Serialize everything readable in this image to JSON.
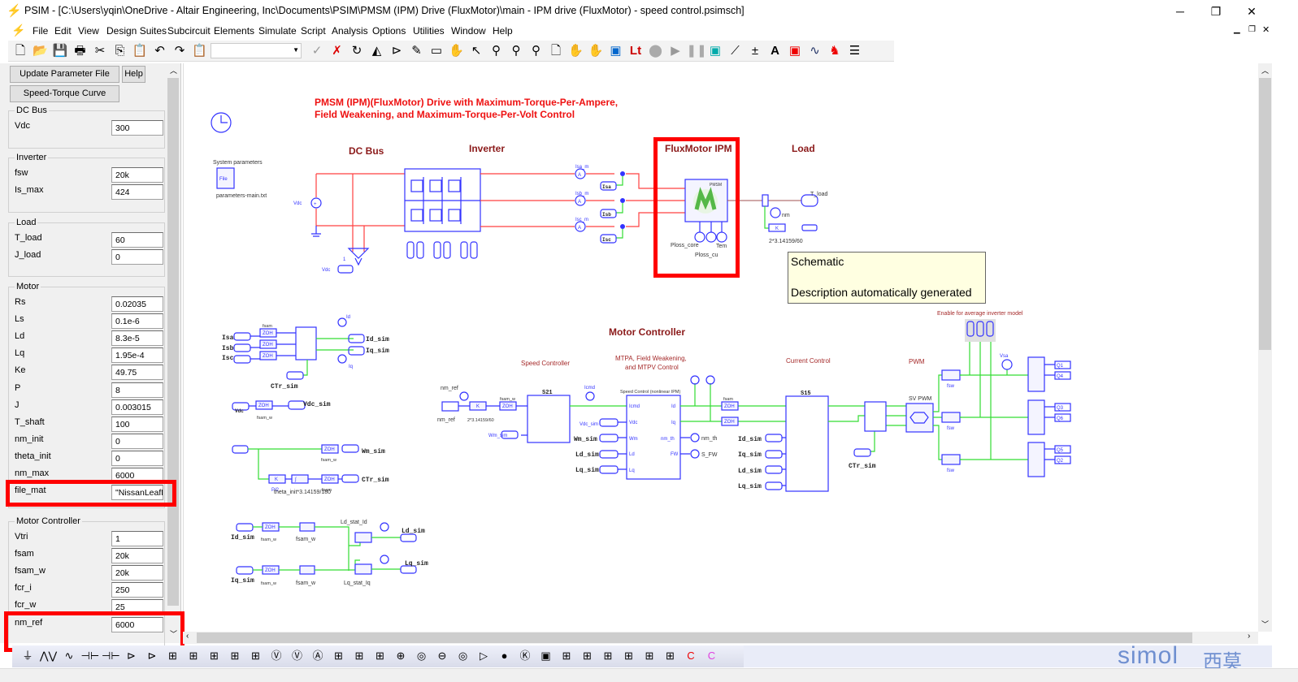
{
  "window": {
    "title": "PSIM - [C:\\Users\\yqin\\OneDrive - Altair Engineering, Inc\\Documents\\PSIM\\PMSM (IPM) Drive (FluxMotor)\\main - IPM drive (FluxMotor) - speed control.psimsch]",
    "minimize": "─",
    "restore": "❐",
    "close": "✕"
  },
  "menu": [
    "File",
    "Edit",
    "View",
    "Design Suites",
    "Subcircuit",
    "Elements",
    "Simulate",
    "Script",
    "Analysis",
    "Options",
    "Utilities",
    "Window",
    "Help"
  ],
  "toolbar": {
    "icons": [
      "new-file",
      "open-folder",
      "save",
      "print",
      "cut",
      "copy",
      "paste",
      "undo",
      "redo",
      "clipboard-check",
      "dropdown",
      "check",
      "delete-x",
      "rotate",
      "flip-horizontal",
      "flip-vertical",
      "wire-pencil",
      "label",
      "hand-pan",
      "select-arrow",
      "zoom",
      "zoom-in",
      "zoom-out",
      "page",
      "hand-red",
      "hand-plus",
      "simview",
      "lt-label",
      "stop",
      "run",
      "pause",
      "scope",
      "edit-wire",
      "edit-param",
      "text-a",
      "red-tool",
      "waveform",
      "elephant",
      "properties"
    ],
    "combo_value": ""
  },
  "panel": {
    "buttons": {
      "update": "Update Parameter File",
      "help": "Help",
      "speed_torque": "Speed-Torque Curve"
    },
    "groups": [
      {
        "title": "DC Bus",
        "fields": [
          {
            "label": "Vdc",
            "value": "300"
          }
        ]
      },
      {
        "title": "Inverter",
        "fields": [
          {
            "label": "fsw",
            "value": "20k"
          },
          {
            "label": "Is_max",
            "value": "424"
          }
        ]
      },
      {
        "title": "Load",
        "fields": [
          {
            "label": "T_load",
            "value": "60"
          },
          {
            "label": "J_load",
            "value": "0"
          }
        ]
      },
      {
        "title": "Motor",
        "fields": [
          {
            "label": "Rs",
            "value": "0.02035"
          },
          {
            "label": "Ls",
            "value": "0.1e-6"
          },
          {
            "label": "Ld",
            "value": "8.3e-5"
          },
          {
            "label": "Lq",
            "value": "1.95e-4"
          },
          {
            "label": "Ke",
            "value": "49.75"
          },
          {
            "label": "P",
            "value": "8"
          },
          {
            "label": "J",
            "value": "0.003015"
          },
          {
            "label": "T_shaft",
            "value": "100"
          },
          {
            "label": "nm_init",
            "value": "0"
          },
          {
            "label": "theta_init",
            "value": "0"
          },
          {
            "label": "nm_max",
            "value": "6000"
          },
          {
            "label": "file_mat",
            "value": "\"NissanLeafLi"
          }
        ]
      },
      {
        "title": "Motor Controller",
        "fields": [
          {
            "label": "Vtri",
            "value": "1"
          },
          {
            "label": "fsam",
            "value": "20k"
          },
          {
            "label": "fsam_w",
            "value": "20k"
          },
          {
            "label": "fcr_i",
            "value": "250"
          },
          {
            "label": "fcr_w",
            "value": "25"
          },
          {
            "label": "nm_ref",
            "value": "6000"
          }
        ]
      }
    ]
  },
  "highlight_color": "#ff0000",
  "schematic": {
    "title_line1": "PMSM (IPM)(FluxMotor) Drive with Maximum-Torque-Per-Ampere,",
    "title_line2": "Field Weakening, and Maximum-Torque-Per-Volt Control",
    "sections": {
      "dc_bus": "DC Bus",
      "inverter": "Inverter",
      "fluxmotor": "FluxMotor IPM",
      "load": "Load",
      "motor_controller": "Motor Controller"
    },
    "subsections": {
      "speed_controller": "Speed Controller",
      "mtpa_1": "MTPA, Field Weakening,",
      "mtpa_2": "and MTPV Control",
      "current_control": "Current Control",
      "pwm": "PWM",
      "enable_avg": "Enable for average inverter model"
    },
    "labels": {
      "system_parameters": "System parameters",
      "file": "File",
      "parameters_file": "parameters-main.txt",
      "vdc": "Vdc",
      "one": "1",
      "isa_m": "Isa_m",
      "isb_m": "Isb_m",
      "isc_m": "Isc_m",
      "isa": "Isa",
      "isb": "Isb",
      "isc": "Isc",
      "pmsm": "PMSM",
      "ploss_core": "Ploss_core",
      "ploss_cu": "Ploss_cu",
      "tem": "Tem",
      "t_load": "T_load",
      "nm": "nm",
      "k": "K",
      "rpm_gain": "2*3.14159/60",
      "zoh": "ZOH",
      "fsam": "fsam",
      "fsam_w": "fsam_w",
      "id": "Id",
      "iq": "Iq",
      "id_sim": "Id_sim",
      "iq_sim": "Iq_sim",
      "ctr_sim": "CTr_sim",
      "vdc_sim": "Vdc_sim",
      "wm_sim": "Wm_sim",
      "p2": "P/2",
      "theta": "theta_init*3.14159/180",
      "ld_stat_id": "Ld_stat_Id",
      "lq_stat_iq": "Lq_stat_Iq",
      "ld_sim": "Ld_sim",
      "lq_sim": "Lq_sim",
      "nm_ref": "nm_ref",
      "s21": "S21",
      "icmd": "Icmd",
      "speed_control": "Speed Control (nonlinear IPM)",
      "vdc_port": "Vdc",
      "wm_port": "Wm",
      "ld_port": "Ld",
      "lq_port": "Lq",
      "id_port": "Id",
      "iq_port": "Iq",
      "nm_th_port": "nm_th",
      "fw_port": "FW",
      "nm_th": "nm_th",
      "s_fw": "S_FW",
      "s15": "S15",
      "sv_pwm": "SV PWM",
      "fsw": "fsw",
      "vsa": "Vsa",
      "q1": "Q1",
      "q4": "Q4",
      "q3": "Q3",
      "q6": "Q6",
      "q5": "Q5",
      "q2": "Q2"
    }
  },
  "tooltip": {
    "line1": "Schematic",
    "line2": "Description automatically generated"
  },
  "logo": {
    "text": "simol",
    "cn": "西莫"
  }
}
